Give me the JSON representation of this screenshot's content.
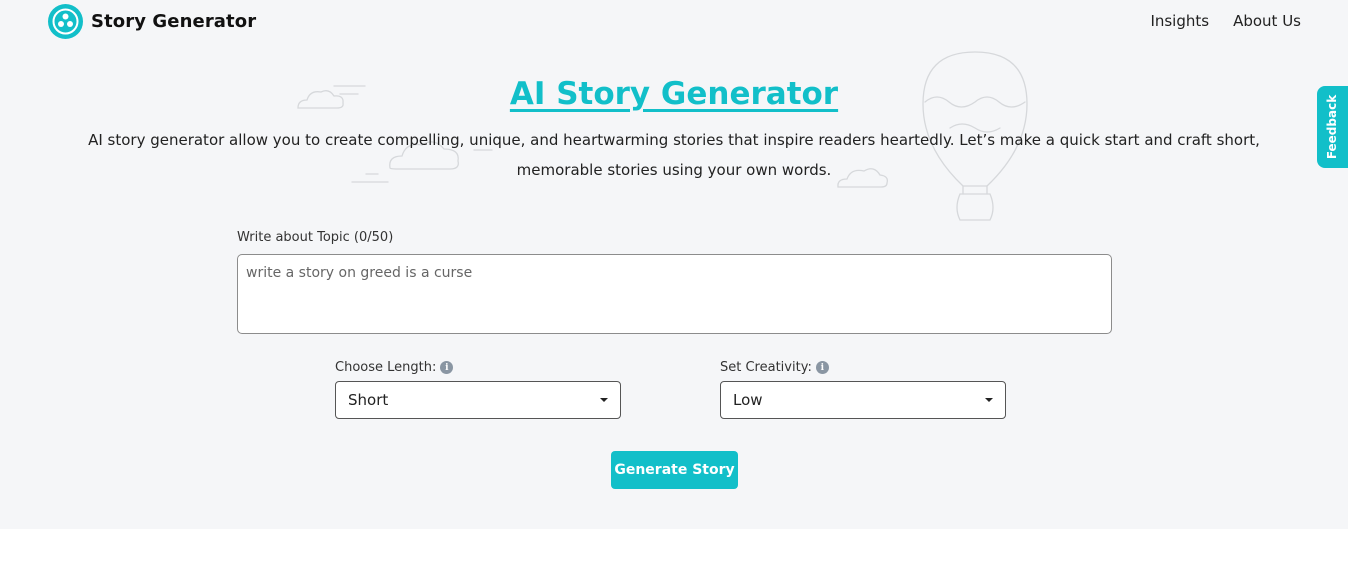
{
  "brand": {
    "name": "Story Generator",
    "accent": "#12bfc9"
  },
  "nav": {
    "items": [
      "Insights",
      "About Us"
    ]
  },
  "hero": {
    "title": "AI Story Generator",
    "description": "AI story generator allow you to create compelling, unique, and heartwarming stories that inspire readers heartedly. Let’s make a quick start and craft short, memorable stories using your own words."
  },
  "form": {
    "topic_label": "Write about Topic (0/50)",
    "topic_placeholder": "write a story on greed is a curse",
    "topic_value": "",
    "length_label": "Choose Length:",
    "length_value": "Short",
    "creativity_label": "Set Creativity:",
    "creativity_value": "Low",
    "info_glyph": "i",
    "generate_label": "Generate Story"
  },
  "feedback_tab": {
    "label": "Feedback"
  },
  "icons": [
    "logo-icon",
    "info-icon",
    "chevron-down-icon",
    "cloud-illustration",
    "balloon-illustration"
  ],
  "colors": {
    "accent": "#12bfc9",
    "hero_bg": "#f5f6f8"
  }
}
